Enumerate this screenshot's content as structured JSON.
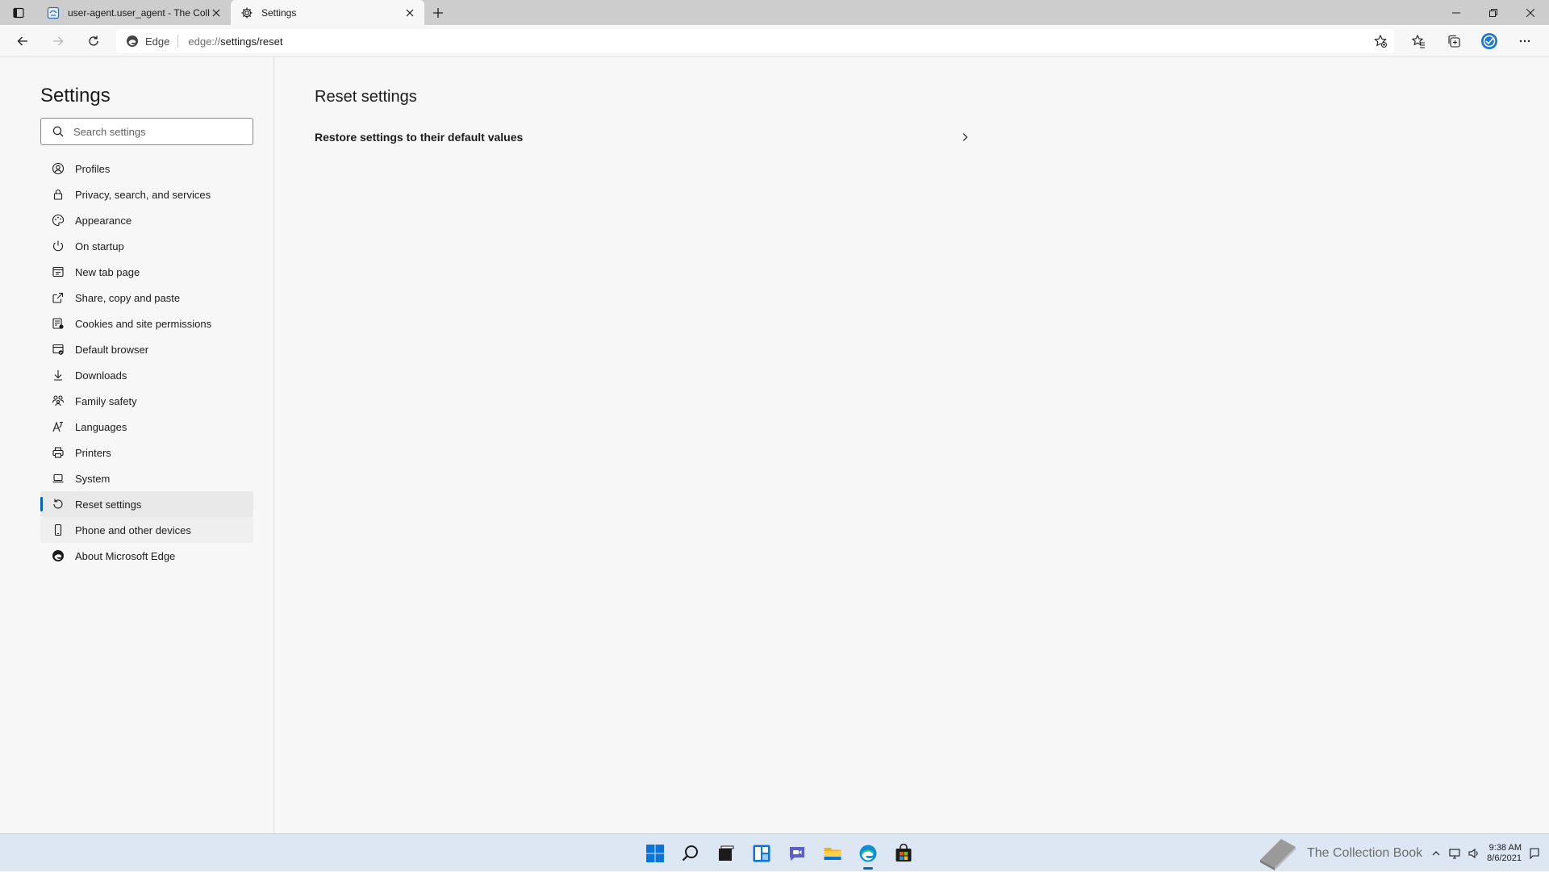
{
  "browser": {
    "tabs": [
      {
        "title": "user-agent.user_agent - The Coll",
        "active": false,
        "icon": "page-favicon-icon"
      },
      {
        "title": "Settings",
        "active": true,
        "icon": "gear-icon"
      }
    ],
    "address": {
      "site_label": "Edge",
      "url_scheme": "edge://",
      "url_path": "settings/reset"
    }
  },
  "sidebar": {
    "title": "Settings",
    "search_placeholder": "Search settings",
    "items": [
      {
        "label": "Profiles",
        "icon": "profile-icon"
      },
      {
        "label": "Privacy, search, and services",
        "icon": "lock-icon"
      },
      {
        "label": "Appearance",
        "icon": "palette-icon"
      },
      {
        "label": "On startup",
        "icon": "power-icon"
      },
      {
        "label": "New tab page",
        "icon": "new-tab-icon"
      },
      {
        "label": "Share, copy and paste",
        "icon": "share-icon"
      },
      {
        "label": "Cookies and site permissions",
        "icon": "cookies-icon"
      },
      {
        "label": "Default browser",
        "icon": "default-browser-icon"
      },
      {
        "label": "Downloads",
        "icon": "download-icon"
      },
      {
        "label": "Family safety",
        "icon": "family-icon"
      },
      {
        "label": "Languages",
        "icon": "languages-icon"
      },
      {
        "label": "Printers",
        "icon": "printer-icon"
      },
      {
        "label": "System",
        "icon": "laptop-icon"
      },
      {
        "label": "Reset settings",
        "icon": "reset-icon",
        "selected": true
      },
      {
        "label": "Phone and other devices",
        "icon": "phone-icon",
        "hover": true
      },
      {
        "label": "About Microsoft Edge",
        "icon": "edge-logo-icon"
      }
    ]
  },
  "main": {
    "title": "Reset settings",
    "rows": [
      {
        "label": "Restore settings to their default values"
      }
    ]
  },
  "taskbar": {
    "apps": [
      "start-icon",
      "search-icon",
      "task-view-icon",
      "widgets-icon",
      "chat-icon",
      "file-explorer-icon",
      "edge-icon",
      "store-icon"
    ],
    "watermark": "The Collection Book",
    "time": "9:38 AM",
    "date": "8/6/2021"
  },
  "colors": {
    "accent": "#0067c0",
    "tabbar_bg": "#cdcdcd",
    "page_bg": "#f7f7f7",
    "taskbar_bg": "#dce7f3"
  }
}
